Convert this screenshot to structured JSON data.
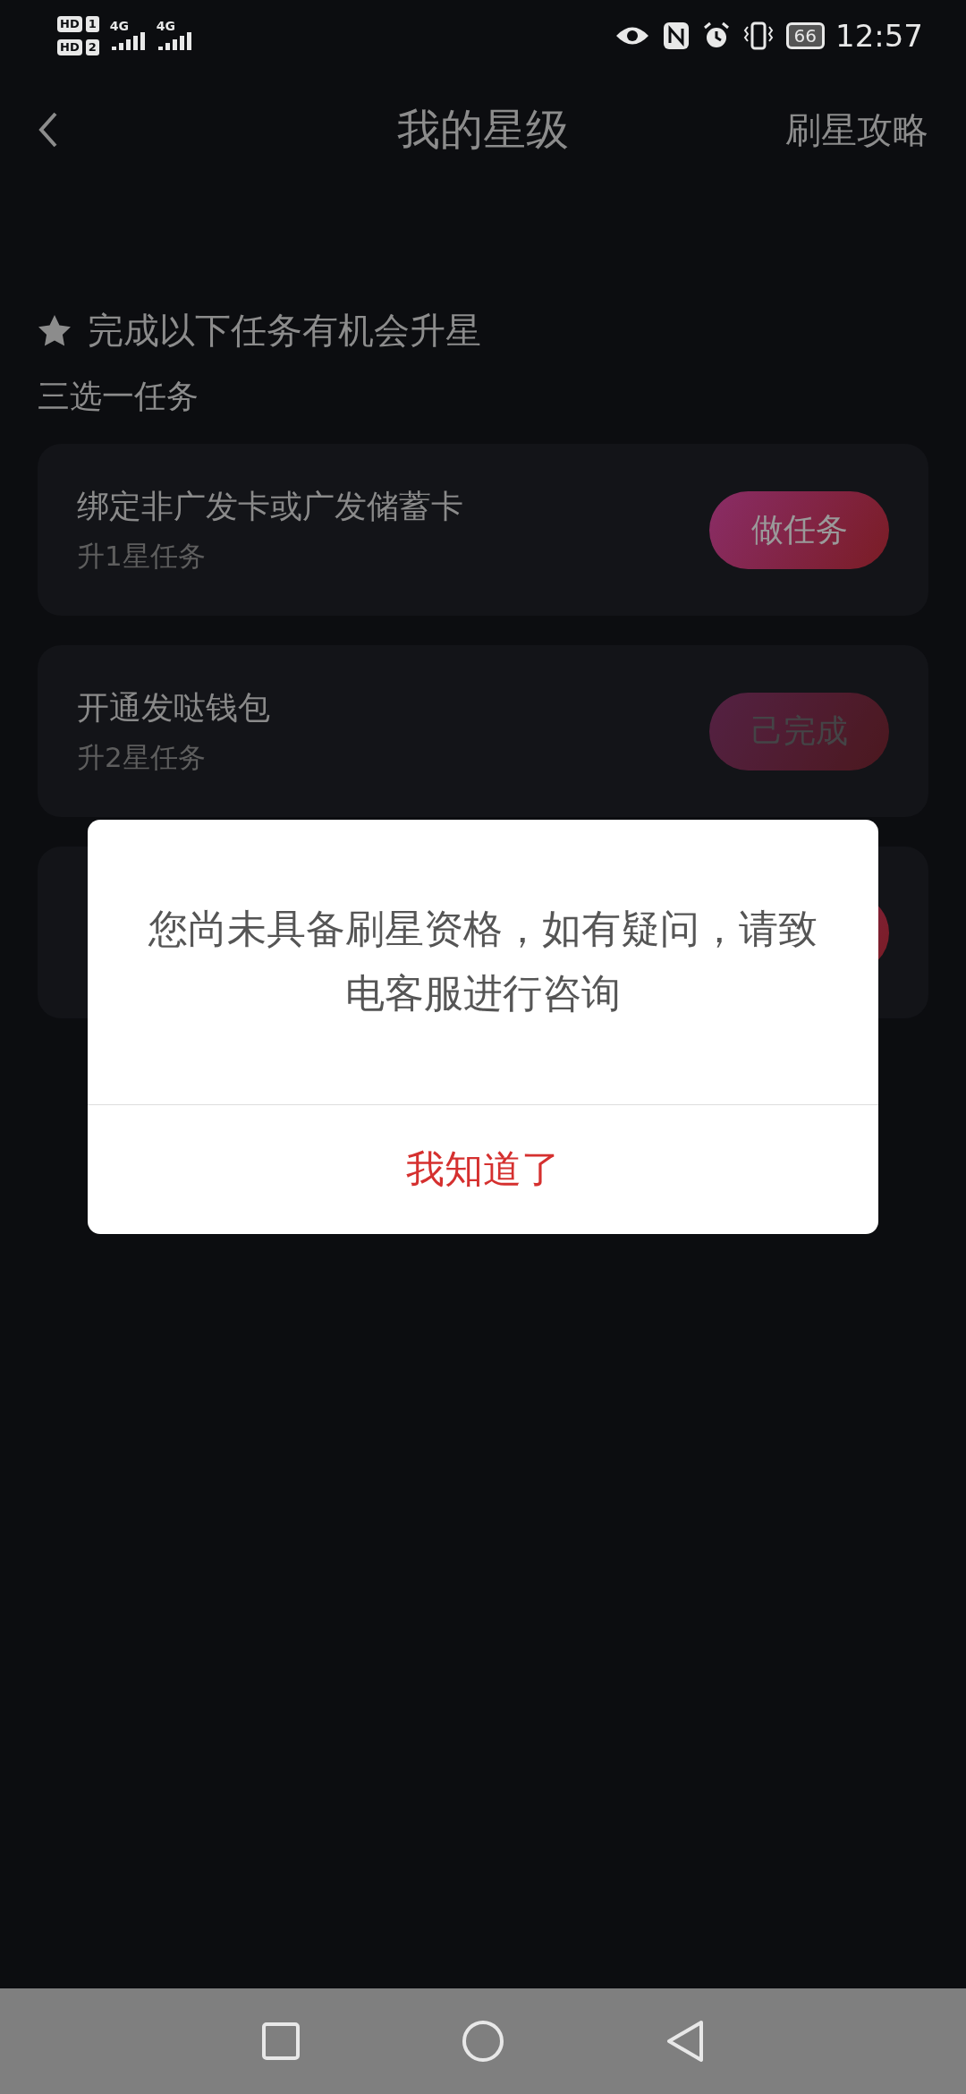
{
  "status_bar": {
    "sims": [
      {
        "hd": "HD",
        "slot": "1",
        "network": "4G"
      },
      {
        "hd": "HD",
        "slot": "2",
        "network": "4G"
      }
    ],
    "battery": "66",
    "time": "12:57"
  },
  "header": {
    "title": "我的星级",
    "action": "刷星攻略"
  },
  "section": {
    "title": "完成以下任务有机会升星",
    "subtitle": "三选一任务"
  },
  "tasks": [
    {
      "title": "绑定非广发卡或广发储蓄卡",
      "subtitle": "升1星任务",
      "button": "做任务",
      "completed": false
    },
    {
      "title": "开通发哒钱包",
      "subtitle": "升2星任务",
      "button": "己完成",
      "completed": true
    },
    {
      "completed": false
    }
  ],
  "dialog": {
    "message": "您尚未具备刷星资格，如有疑问，请致电客服进行咨询",
    "button": "我知道了"
  }
}
